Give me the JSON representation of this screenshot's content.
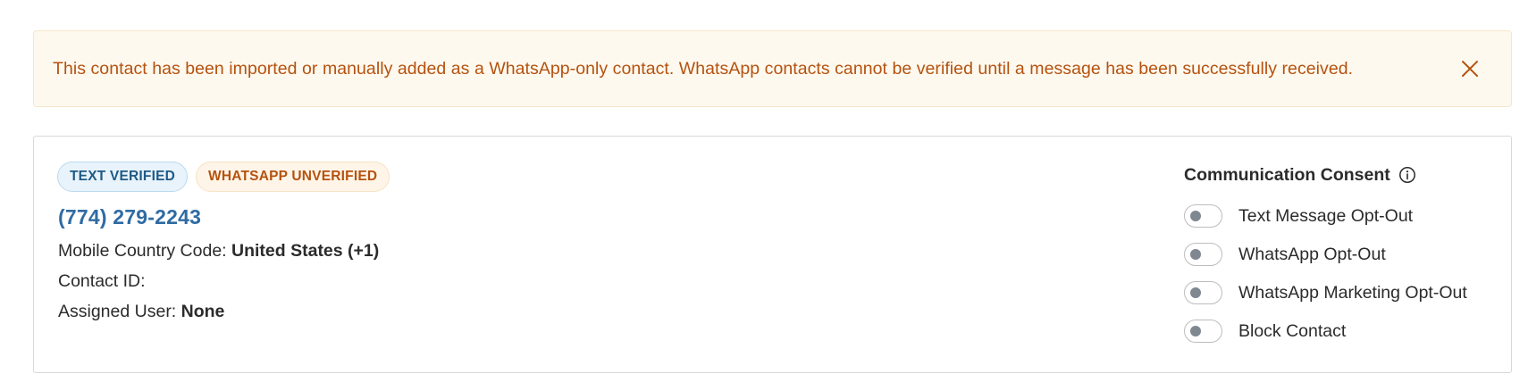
{
  "banner": {
    "message": "This contact has been imported or manually added as a WhatsApp-only contact. WhatsApp contacts cannot be verified until a message has been successfully received.",
    "close_icon": "close-icon",
    "color": "#b5520f",
    "background": "#fef9ef"
  },
  "contact": {
    "badges": [
      {
        "label": "TEXT VERIFIED",
        "color": "#1f5a86"
      },
      {
        "label": "WHATSAPP UNVERIFIED",
        "color": "#b5520f"
      }
    ],
    "phone": "(774) 279-2243",
    "country_code_label": "Mobile Country Code:",
    "country_code_value": "United States (+1)",
    "contact_id_label": "Contact ID:",
    "contact_id_value": "",
    "assigned_user_label": "Assigned User:",
    "assigned_user_value": "None"
  },
  "consent": {
    "title": "Communication Consent",
    "info_icon": "info-icon",
    "toggles": [
      {
        "label": "Text Message Opt-Out",
        "on": false
      },
      {
        "label": "WhatsApp Opt-Out",
        "on": false
      },
      {
        "label": "WhatsApp Marketing Opt-Out",
        "on": false
      },
      {
        "label": "Block Contact",
        "on": false
      }
    ]
  }
}
